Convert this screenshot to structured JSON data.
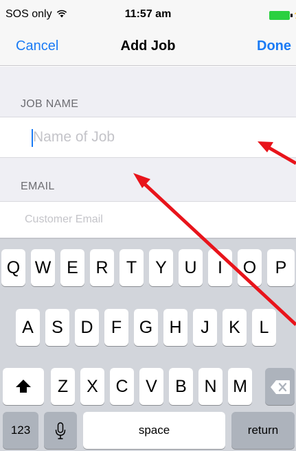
{
  "status_bar": {
    "carrier": "SOS only",
    "wifi_icon": "wifi-icon",
    "time": "11:57 am",
    "battery_icon": "battery-charging-icon",
    "battery_color": "#2bd040"
  },
  "nav": {
    "cancel": "Cancel",
    "title": "Add Job",
    "done": "Done",
    "accent_color": "#1a7bf5"
  },
  "form": {
    "job_name": {
      "header": "JOB NAME",
      "placeholder": "Name of Job",
      "value": ""
    },
    "email": {
      "header": "EMAIL",
      "placeholder": "Customer Email",
      "value": ""
    }
  },
  "keyboard": {
    "row1": [
      "Q",
      "W",
      "E",
      "R",
      "T",
      "Y",
      "U",
      "I",
      "O",
      "P"
    ],
    "row2": [
      "A",
      "S",
      "D",
      "F",
      "G",
      "H",
      "J",
      "K",
      "L"
    ],
    "row3": [
      "Z",
      "X",
      "C",
      "V",
      "B",
      "N",
      "M"
    ],
    "shift_icon": "shift-icon",
    "delete_icon": "delete-icon",
    "numbers_label": "123",
    "mic_icon": "microphone-icon",
    "space_label": "space",
    "return_label": "return"
  },
  "annotation": {
    "arrow_color": "#e8141b"
  }
}
